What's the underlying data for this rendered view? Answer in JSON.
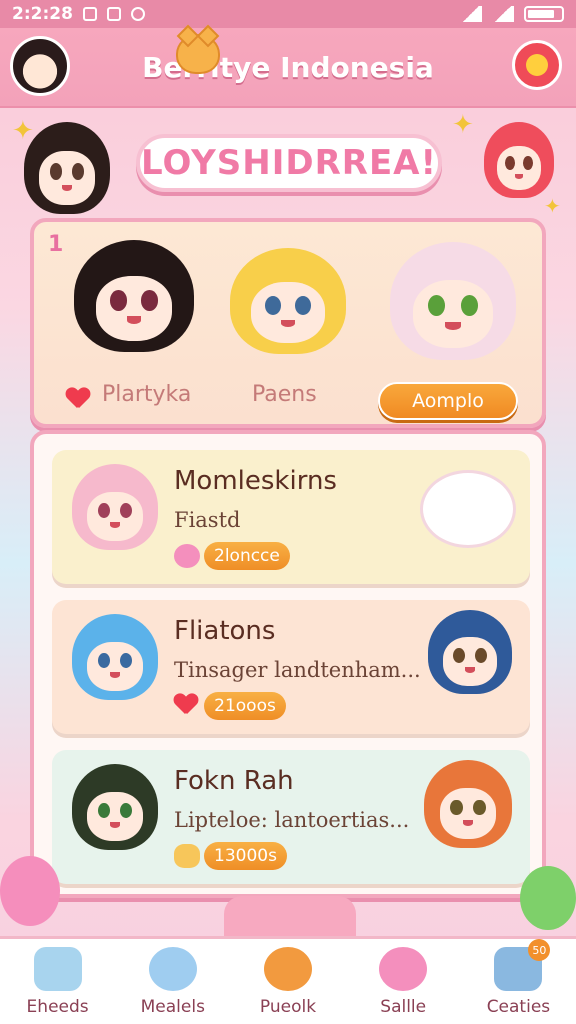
{
  "status_bar": {
    "time": "2:2:28"
  },
  "header": {
    "title": "Berritye Indonesia"
  },
  "banner": {
    "logo_text": "LOYSHIDRREA!"
  },
  "top_panel": {
    "rank": "1",
    "left_label": "Plartyka",
    "middle_label": "Paens",
    "button_label": "Aomplo"
  },
  "cards": [
    {
      "title": "Momleskirns",
      "subtitle": "Fiastd",
      "pill": "2loncce",
      "icon": "blob-icon",
      "bg": "#faf0cd"
    },
    {
      "title": "Fliatons",
      "subtitle": "Tinsager landtenham...",
      "pill": "21ooos",
      "icon": "heart-icon",
      "bg": "#fde4d4"
    },
    {
      "title": "Fokn Rah",
      "subtitle": "Lipteloe: lantoertias...",
      "pill": "13000s",
      "icon": "bear-icon",
      "bg": "#e7f3ec"
    }
  ],
  "nav": [
    {
      "label": "Eheeds",
      "icon": "home-icon",
      "color": "#a8d4ee"
    },
    {
      "label": "Mealels",
      "icon": "bear-icon",
      "color": "#9fcdf0"
    },
    {
      "label": "Pueolk",
      "icon": "cat-icon",
      "color": "#f29a3f"
    },
    {
      "label": "Sallle",
      "icon": "blob-icon",
      "color": "#f48fbd"
    },
    {
      "label": "Ceaties",
      "icon": "list-icon",
      "color": "#8ab8e0",
      "badge": "50"
    }
  ],
  "colors": {
    "accent": "#f3a2ba",
    "button": "#f08a23",
    "panel_border": "#f2a7bd"
  }
}
